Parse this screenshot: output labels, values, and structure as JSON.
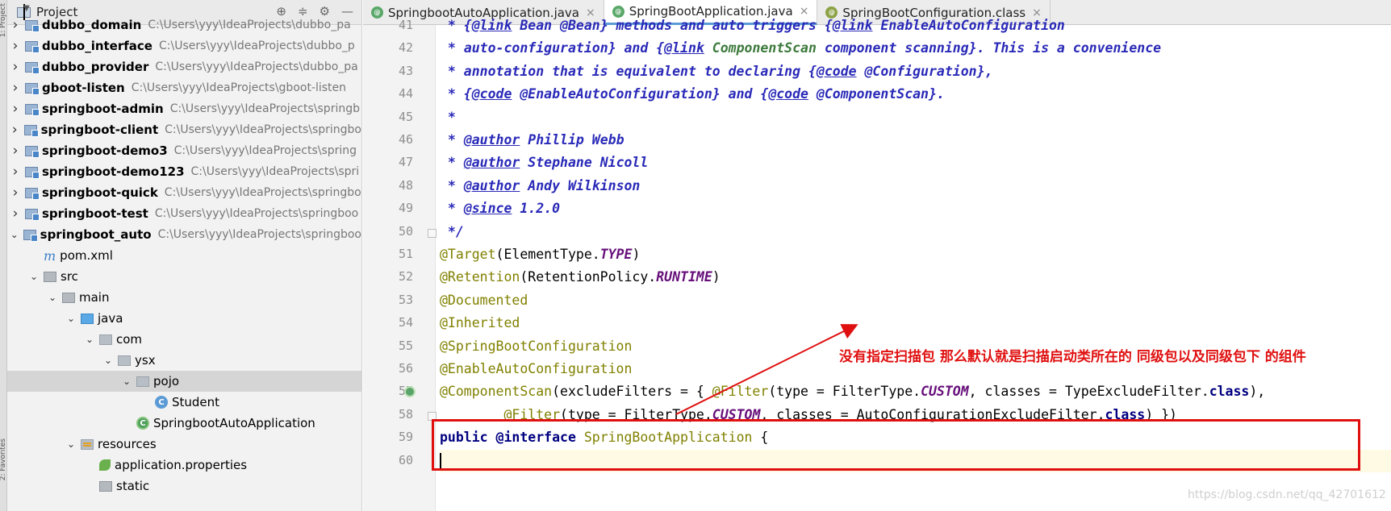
{
  "project_panel": {
    "title": "Project",
    "tree": [
      {
        "name": "dubbo_domain",
        "path": "C:\\Users\\yyy\\IdeaProjects\\dubbo_pa",
        "bold": true,
        "level": 1,
        "arrow": "closed",
        "icon": "module"
      },
      {
        "name": "dubbo_interface",
        "path": "C:\\Users\\yyy\\IdeaProjects\\dubbo_p",
        "bold": true,
        "level": 1,
        "arrow": "closed",
        "icon": "module"
      },
      {
        "name": "dubbo_provider",
        "path": "C:\\Users\\yyy\\IdeaProjects\\dubbo_pa",
        "bold": true,
        "level": 1,
        "arrow": "closed",
        "icon": "module"
      },
      {
        "name": "gboot-listen",
        "path": "C:\\Users\\yyy\\IdeaProjects\\gboot-listen",
        "bold": true,
        "level": 1,
        "arrow": "closed",
        "icon": "module"
      },
      {
        "name": "springboot-admin",
        "path": "C:\\Users\\yyy\\IdeaProjects\\springb",
        "bold": true,
        "level": 1,
        "arrow": "closed",
        "icon": "module"
      },
      {
        "name": "springboot-client",
        "path": "C:\\Users\\yyy\\IdeaProjects\\springbo",
        "bold": true,
        "level": 1,
        "arrow": "closed",
        "icon": "module"
      },
      {
        "name": "springboot-demo3",
        "path": "C:\\Users\\yyy\\IdeaProjects\\spring",
        "bold": true,
        "level": 1,
        "arrow": "closed",
        "icon": "module"
      },
      {
        "name": "springboot-demo123",
        "path": "C:\\Users\\yyy\\IdeaProjects\\spri",
        "bold": true,
        "level": 1,
        "arrow": "closed",
        "icon": "module"
      },
      {
        "name": "springboot-quick",
        "path": "C:\\Users\\yyy\\IdeaProjects\\springbo",
        "bold": true,
        "level": 1,
        "arrow": "closed",
        "icon": "module"
      },
      {
        "name": "springboot-test",
        "path": "C:\\Users\\yyy\\IdeaProjects\\springboo",
        "bold": true,
        "level": 1,
        "arrow": "closed",
        "icon": "module"
      },
      {
        "name": "springboot_auto",
        "path": "C:\\Users\\yyy\\IdeaProjects\\springboo",
        "bold": true,
        "level": 1,
        "arrow": "open",
        "icon": "module"
      },
      {
        "name": "pom.xml",
        "path": "",
        "bold": false,
        "level": 2,
        "arrow": "none",
        "icon": "maven"
      },
      {
        "name": "src",
        "path": "",
        "bold": false,
        "level": 2,
        "arrow": "open",
        "icon": "folder"
      },
      {
        "name": "main",
        "path": "",
        "bold": false,
        "level": 3,
        "arrow": "open",
        "icon": "folder"
      },
      {
        "name": "java",
        "path": "",
        "bold": false,
        "level": 4,
        "arrow": "open",
        "icon": "java-folder"
      },
      {
        "name": "com",
        "path": "",
        "bold": false,
        "level": 5,
        "arrow": "open",
        "icon": "package"
      },
      {
        "name": "ysx",
        "path": "",
        "bold": false,
        "level": 6,
        "arrow": "open",
        "icon": "package"
      },
      {
        "name": "pojo",
        "path": "",
        "bold": false,
        "level": 7,
        "arrow": "open",
        "icon": "package",
        "selected": true
      },
      {
        "name": "Student",
        "path": "",
        "bold": false,
        "level": 8,
        "arrow": "none",
        "icon": "class"
      },
      {
        "name": "SpringbootAutoApplication",
        "path": "",
        "bold": false,
        "level": 7,
        "arrow": "none",
        "icon": "spring-class"
      },
      {
        "name": "resources",
        "path": "",
        "bold": false,
        "level": 4,
        "arrow": "open",
        "icon": "resources"
      },
      {
        "name": "application.properties",
        "path": "",
        "bold": false,
        "level": 5,
        "arrow": "none",
        "icon": "spring-leaf"
      },
      {
        "name": "static",
        "path": "",
        "bold": false,
        "level": 5,
        "arrow": "none",
        "icon": "folder"
      }
    ]
  },
  "tabs": [
    {
      "label": "SpringbootAutoApplication.java",
      "active": false,
      "icon": "spring-class-icon"
    },
    {
      "label": "SpringBootApplication.java",
      "active": true,
      "icon": "spring-class-icon"
    },
    {
      "label": "SpringBootConfiguration.class",
      "active": false,
      "icon": "class-file-icon"
    }
  ],
  "editor": {
    "line_numbers": [
      "41",
      "42",
      "43",
      "44",
      "45",
      "46",
      "47",
      "48",
      "49",
      "50",
      "51",
      "52",
      "53",
      "54",
      "55",
      "56",
      "57",
      "58",
      "59",
      "60"
    ],
    "lines": [
      [
        {
          "t": " * {",
          "c": "doc"
        },
        {
          "t": "@link",
          "c": "tag"
        },
        {
          "t": " Bean @Bean} methods and auto triggers {",
          "c": "doc"
        },
        {
          "t": "@link",
          "c": "tag"
        },
        {
          "t": " EnableAutoConfiguration",
          "c": "doc"
        }
      ],
      [
        {
          "t": " * ",
          "c": "doc"
        },
        {
          "t": "auto-configuration",
          "c": "doc"
        },
        {
          "t": "} and {",
          "c": "doc"
        },
        {
          "t": "@link",
          "c": "tag"
        },
        {
          "t": " ComponentScan",
          "c": "green"
        },
        {
          "t": " component scanning}. This is a convenience",
          "c": "doc"
        }
      ],
      [
        {
          "t": " * annotation that is equivalent to declaring {",
          "c": "doc"
        },
        {
          "t": "@code",
          "c": "tag"
        },
        {
          "t": " @Configuration},",
          "c": "doc"
        }
      ],
      [
        {
          "t": " * {",
          "c": "doc"
        },
        {
          "t": "@code",
          "c": "tag"
        },
        {
          "t": " @EnableAutoConfiguration} and {",
          "c": "doc"
        },
        {
          "t": "@code",
          "c": "tag"
        },
        {
          "t": " @ComponentScan}.",
          "c": "doc"
        }
      ],
      [
        {
          "t": " *",
          "c": "doc"
        }
      ],
      [
        {
          "t": " * ",
          "c": "doc"
        },
        {
          "t": "@author",
          "c": "tag"
        },
        {
          "t": " Phillip Webb",
          "c": "doc"
        }
      ],
      [
        {
          "t": " * ",
          "c": "doc"
        },
        {
          "t": "@author",
          "c": "tag"
        },
        {
          "t": " Stephane Nicoll",
          "c": "doc"
        }
      ],
      [
        {
          "t": " * ",
          "c": "doc"
        },
        {
          "t": "@author",
          "c": "tag"
        },
        {
          "t": " Andy Wilkinson",
          "c": "doc"
        }
      ],
      [
        {
          "t": " * ",
          "c": "doc"
        },
        {
          "t": "@since",
          "c": "tag"
        },
        {
          "t": " 1.2.0",
          "c": "doc"
        }
      ],
      [
        {
          "t": " */",
          "c": "doc"
        }
      ],
      [
        {
          "t": "@Target",
          "c": "ann"
        },
        {
          "t": "(ElementType.",
          "c": "plain"
        },
        {
          "t": "TYPE",
          "c": "const"
        },
        {
          "t": ")",
          "c": "plain"
        }
      ],
      [
        {
          "t": "@Retention",
          "c": "ann"
        },
        {
          "t": "(RetentionPolicy.",
          "c": "plain"
        },
        {
          "t": "RUNTIME",
          "c": "const"
        },
        {
          "t": ")",
          "c": "plain"
        }
      ],
      [
        {
          "t": "@Documented",
          "c": "ann"
        }
      ],
      [
        {
          "t": "@Inherited",
          "c": "ann"
        }
      ],
      [
        {
          "t": "@SpringBootConfiguration",
          "c": "ann"
        }
      ],
      [
        {
          "t": "@EnableAutoConfiguration",
          "c": "ann"
        }
      ],
      [
        {
          "t": "@ComponentScan",
          "c": "ann"
        },
        {
          "t": "(excludeFilters = { ",
          "c": "plain"
        },
        {
          "t": "@Filter",
          "c": "ann"
        },
        {
          "t": "(type = FilterType.",
          "c": "plain"
        },
        {
          "t": "CUSTOM",
          "c": "const"
        },
        {
          "t": ", classes = TypeExcludeFilter.",
          "c": "plain"
        },
        {
          "t": "class",
          "c": "kw"
        },
        {
          "t": "),",
          "c": "plain"
        }
      ],
      [
        {
          "t": "        ",
          "c": "plain"
        },
        {
          "t": "@Filter",
          "c": "ann"
        },
        {
          "t": "(type = FilterType.",
          "c": "plain"
        },
        {
          "t": "CUSTOM",
          "c": "const"
        },
        {
          "t": ", classes = AutoConfigurationExcludeFilter.",
          "c": "plain"
        },
        {
          "t": "class",
          "c": "kw"
        },
        {
          "t": ") })",
          "c": "plain"
        }
      ],
      [
        {
          "t": "public ",
          "c": "kw"
        },
        {
          "t": "@interface ",
          "c": "kw"
        },
        {
          "t": "SpringBootApplication",
          "c": "cls"
        },
        {
          "t": " {",
          "c": "plain"
        }
      ],
      [
        {
          "t": "",
          "c": "plain"
        }
      ]
    ]
  },
  "annotation": {
    "text": "没有指定扫描包 那么默认就是扫描启动类所在的 同级包以及同级包下 的组件",
    "color": "#e01010"
  },
  "watermark": "https://blog.csdn.net/qq_42701612",
  "side_strip": {
    "top_label": "1: Project",
    "bottom_label": "2: Favorites"
  }
}
